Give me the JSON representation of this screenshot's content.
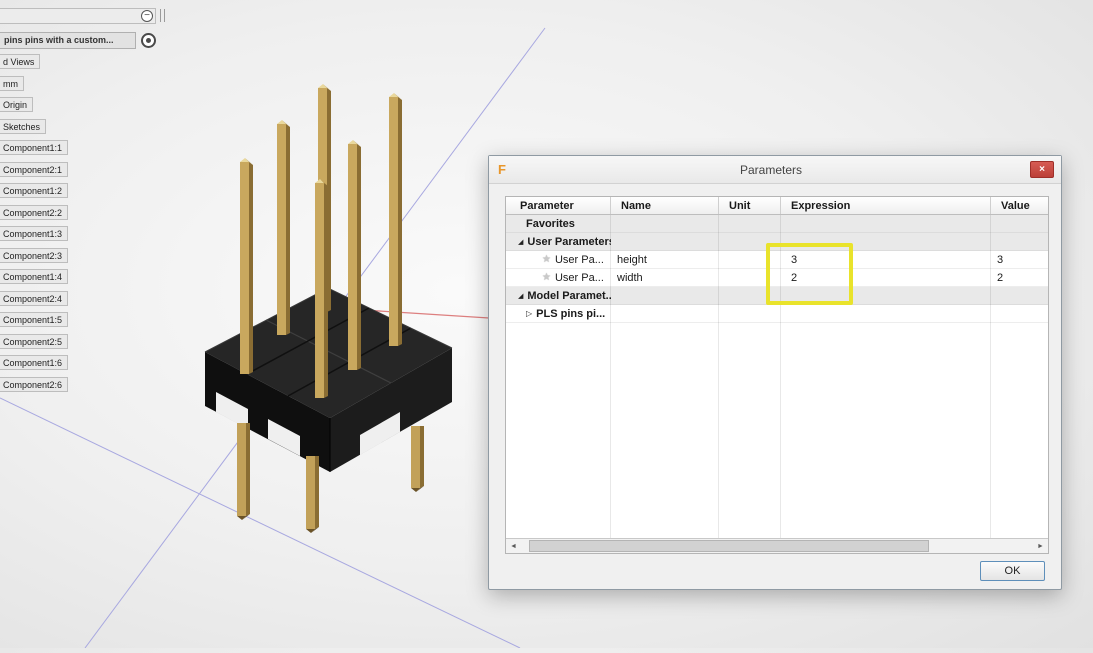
{
  "browser": {
    "collapse_button": "−",
    "doc_tab": "pins pins with a custom...",
    "items": [
      "d Views",
      "mm",
      "Origin",
      "Sketches",
      "Component1:1",
      "Component2:1",
      "Component1:2",
      "Component2:2",
      "Component1:3",
      "Component2:3",
      "Component1:4",
      "Component2:4",
      "Component1:5",
      "Component2:5",
      "Component1:6",
      "Component2:6"
    ]
  },
  "canvas": {
    "model": "2x3 pin header with gold pins and black housing",
    "colors": {
      "pin_gold": "#c9a85e",
      "pin_gold_dark": "#8a6d33",
      "pin_gold_light": "#e9d89c",
      "body_black": "#161616",
      "axis_blue": "#a8a8e0",
      "axis_red": "#dd7f7f"
    }
  },
  "dialog": {
    "title": "Parameters",
    "logo": "F",
    "close": "×",
    "columns": {
      "parameter": "Parameter",
      "name": "Name",
      "unit": "Unit",
      "expression": "Expression",
      "value": "Value"
    },
    "rows": {
      "favorites": {
        "label": "Favorites"
      },
      "user_parameters": {
        "label": "User Parameters",
        "expand_glyph": "◢",
        "add_glyph": "+"
      },
      "height": {
        "label": "User Pa...",
        "star_glyph": "★",
        "name": "height",
        "unit": "",
        "expression": "3",
        "value": "3"
      },
      "width": {
        "label": "User Pa...",
        "star_glyph": "★",
        "name": "width",
        "unit": "",
        "expression": "2",
        "value": "2"
      },
      "model_parameters": {
        "label": "Model Paramet...",
        "expand_glyph": "◢"
      },
      "pls": {
        "label": "PLS pins pi...",
        "collapse_glyph": "▷"
      }
    },
    "scrollbar": {
      "left_arrow": "◄",
      "right_arrow": "►"
    },
    "ok_button": "OK",
    "highlight_color": "#e9e32b"
  }
}
